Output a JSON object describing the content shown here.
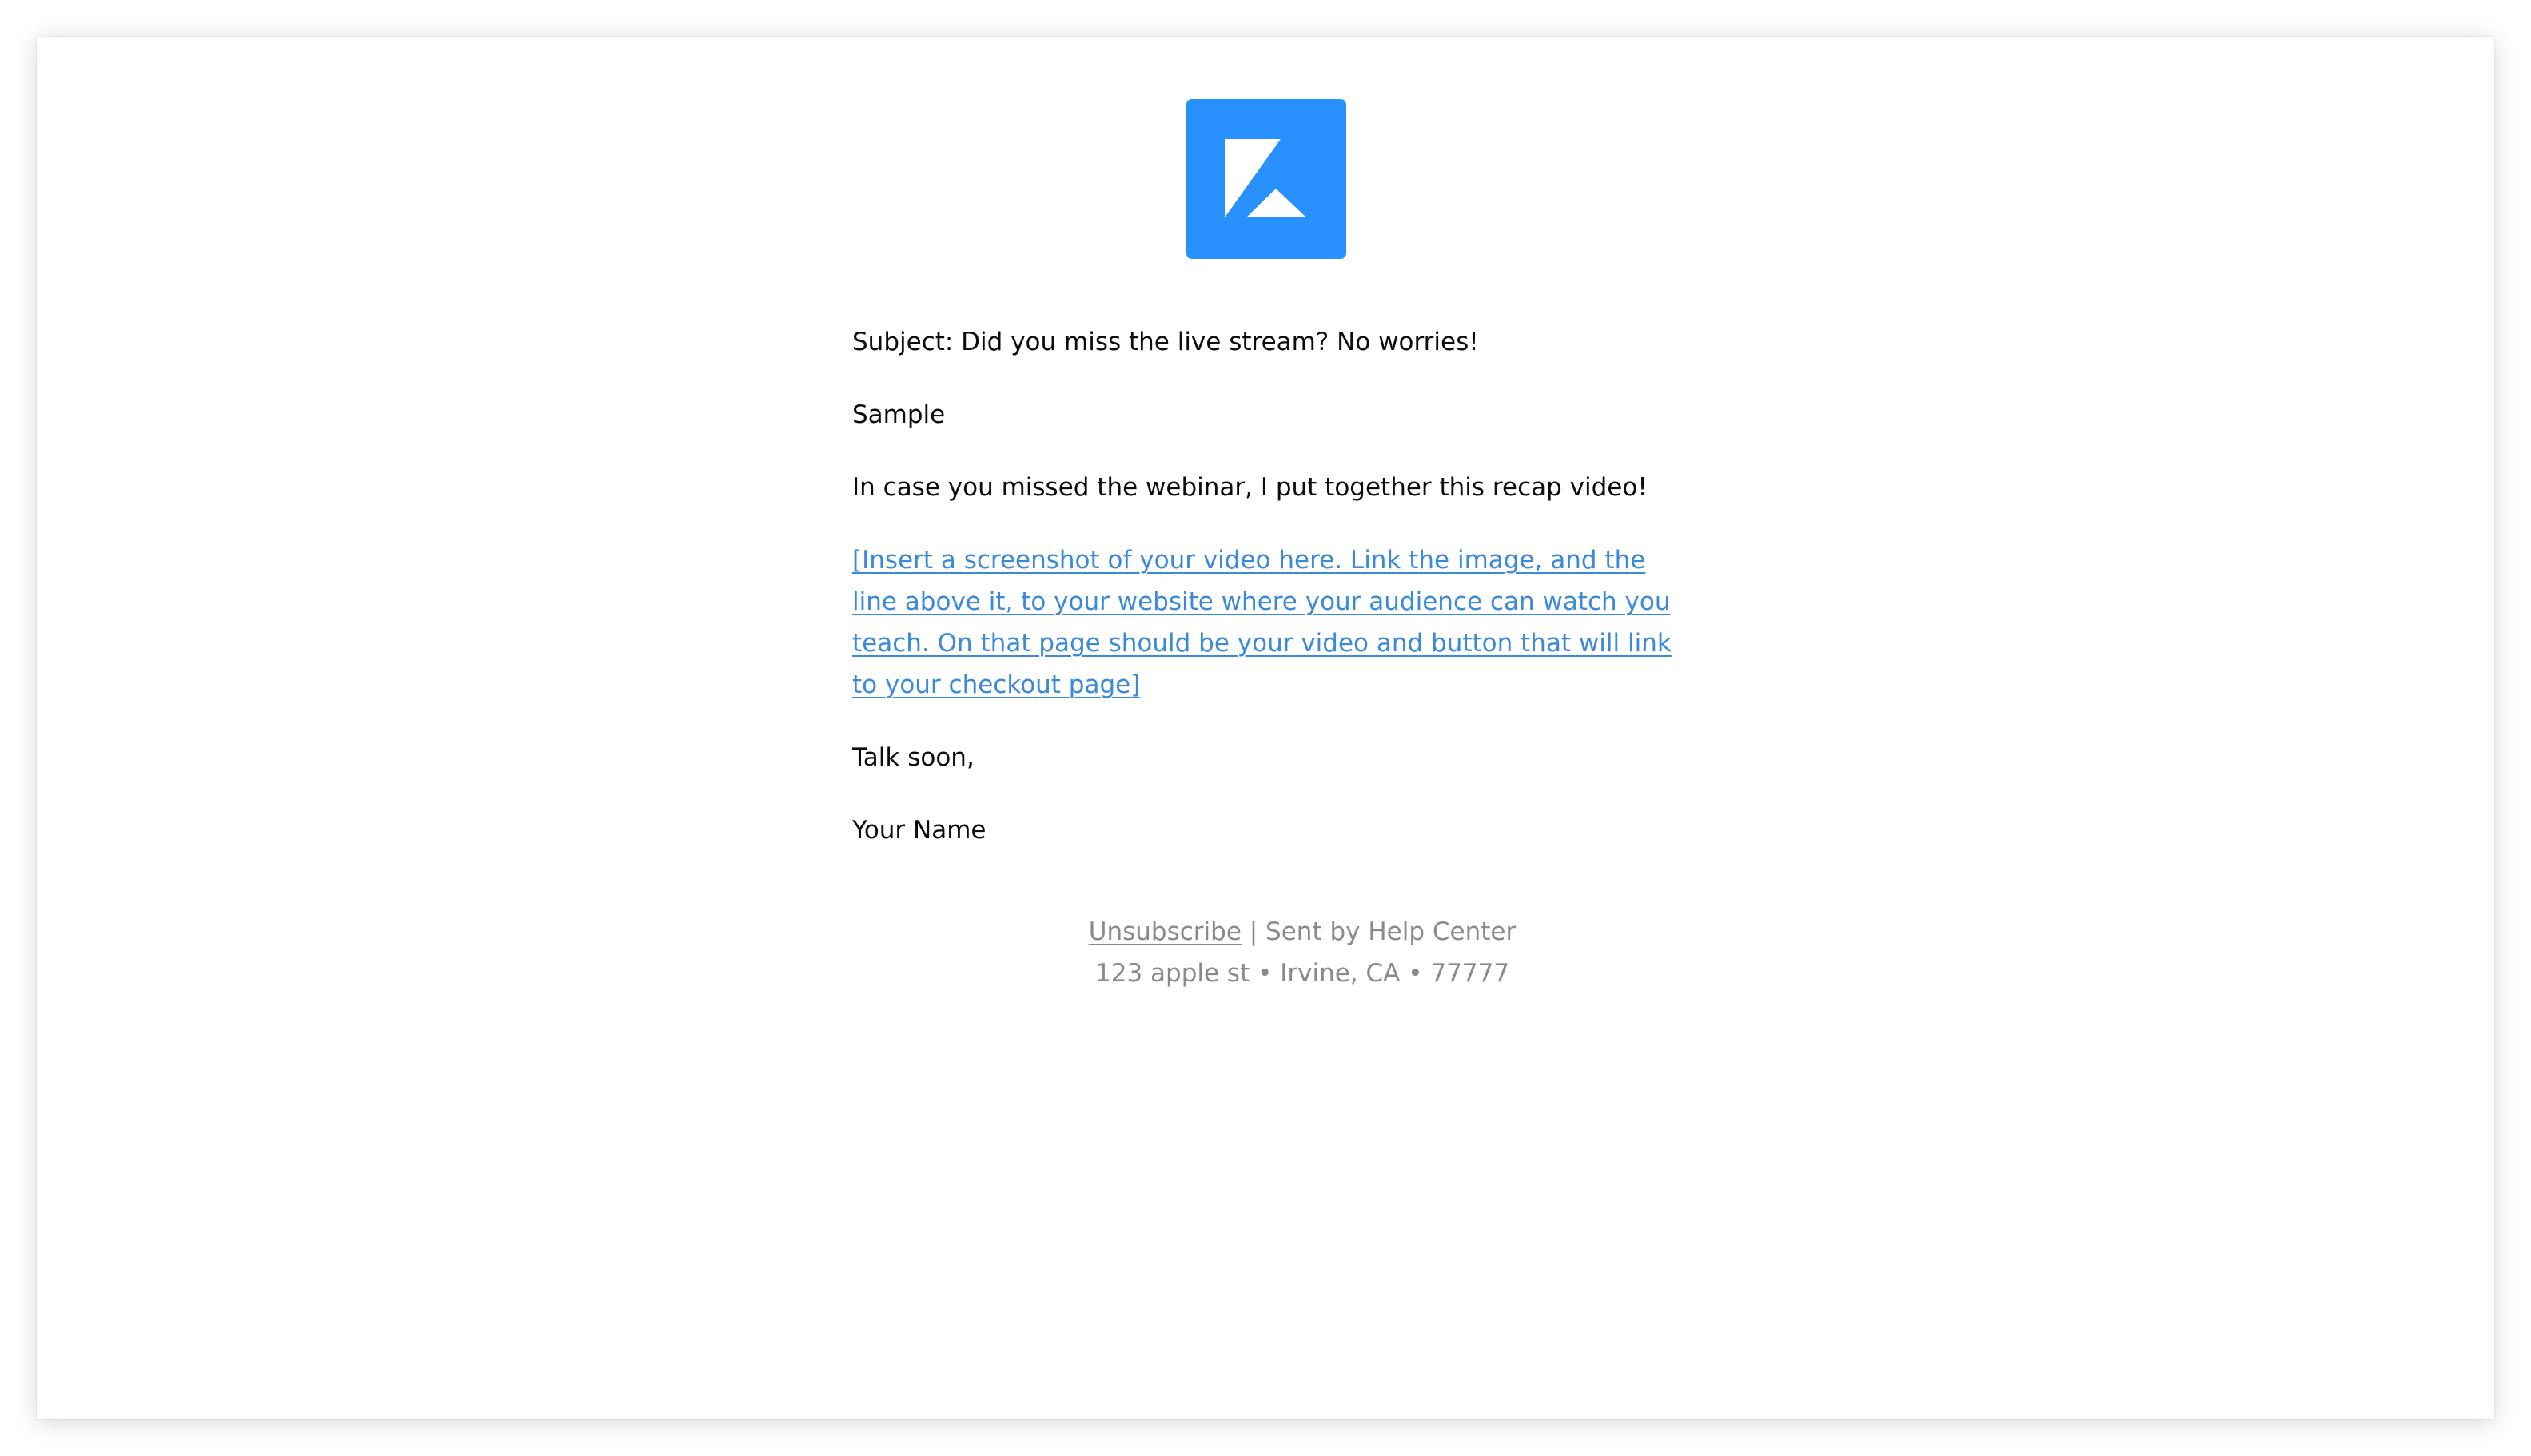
{
  "brand": {
    "logo_icon": "kajabi-k-logo-icon",
    "accent_color": "#2891ff"
  },
  "email": {
    "subject_line": "Subject: Did you miss the live stream? No worries!",
    "greeting": "Sample",
    "intro": "In case you missed the webinar, I put together this recap video!",
    "video_link_text": "[Insert a screenshot of your video here. Link the image, and the line above it, to your website where your audience can watch you teach. On that page should be your video and button that will link to your checkout page]",
    "signoff": "Talk soon,",
    "signature": "Your Name",
    "link_color": "#3a8ad9"
  },
  "footer": {
    "unsubscribe_label": "Unsubscribe",
    "sent_by": " | Sent by Help Center",
    "address": "123 apple st • Irvine, CA • 77777"
  }
}
